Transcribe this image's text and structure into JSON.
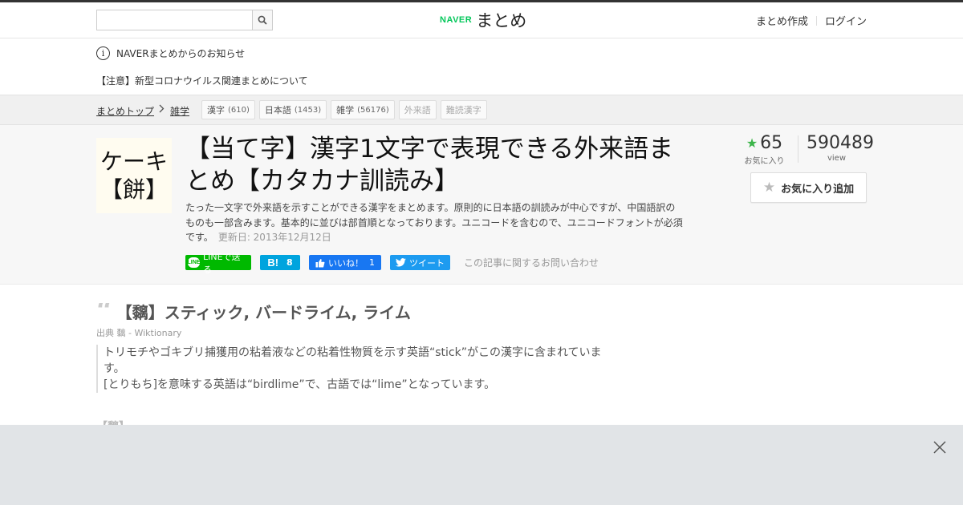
{
  "header": {
    "search": {
      "value": "",
      "placeholder": ""
    },
    "logo": {
      "brand": "NAVER",
      "name": "まとめ"
    },
    "links": {
      "create": "まとめ作成",
      "login": "ログイン"
    }
  },
  "notice": {
    "heading": "NAVERまとめからのお知らせ",
    "link": "【注意】新型コロナウイルス関連まとめについて"
  },
  "breadcrumb": {
    "items": [
      "まとめトップ",
      "雑学"
    ],
    "tags": [
      {
        "label": "漢字",
        "count": "(610)"
      },
      {
        "label": "日本語",
        "count": "(1453)"
      },
      {
        "label": "雑学",
        "count": "(56176)"
      },
      {
        "label": "外来語",
        "count": ""
      },
      {
        "label": "難読漢字",
        "count": ""
      }
    ]
  },
  "article": {
    "thumbnail": {
      "line1": "ケーキ",
      "line2": "【餅】"
    },
    "title": "【当て字】漢字1文字で表現できる外来語まとめ【カタカナ訓読み】",
    "description": "たった一文字で外来語を示すことができる漢字をまとめます。原則的に日本語の訓読みが中心ですが、中国語訳のものも一部含みます。基本的に並びは部首順となっております。ユニコードを含むので、ユニコードフォントが必須です。",
    "updated": "更新日: 2013年12月12日",
    "share": {
      "line": "LINEで送る",
      "hatena_count": "8",
      "facebook": "いいね！",
      "facebook_count": "1",
      "twitter": "ツイート",
      "contact": "この記事に関するお問い合わせ"
    },
    "stats": {
      "favorites": "65",
      "favorites_label": "お気に入り",
      "views": "590489",
      "views_label": "view"
    },
    "fav_button": "お気に入り追加"
  },
  "content": {
    "quote_title": "【黐】スティック, バードライム, ライム",
    "source": "出典 黐 - Wiktionary",
    "quote_lines": [
      "トリモチやゴキブリ捕獲用の粘着液などの粘着性物質を示す英語“stick”がこの漢字に含まれていま",
      "す。",
      "[とりもち]を意味する英語は“birdlime”で、古語では“lime”となっています。"
    ],
    "next_peek": "【黐】"
  },
  "colors": {
    "brand_green": "#03c75a",
    "line_green": "#00b900",
    "hatena_blue": "#00a4de",
    "facebook_blue": "#1877f2",
    "twitter_blue": "#1d9bf0",
    "star_green": "#3cb54a"
  },
  "icons": [
    "search-icon",
    "info-icon",
    "chevron-right-icon",
    "star-icon",
    "line-icon",
    "hatena-icon",
    "thumbs-up-icon",
    "twitter-bird-icon",
    "quote-icon",
    "close-icon"
  ]
}
